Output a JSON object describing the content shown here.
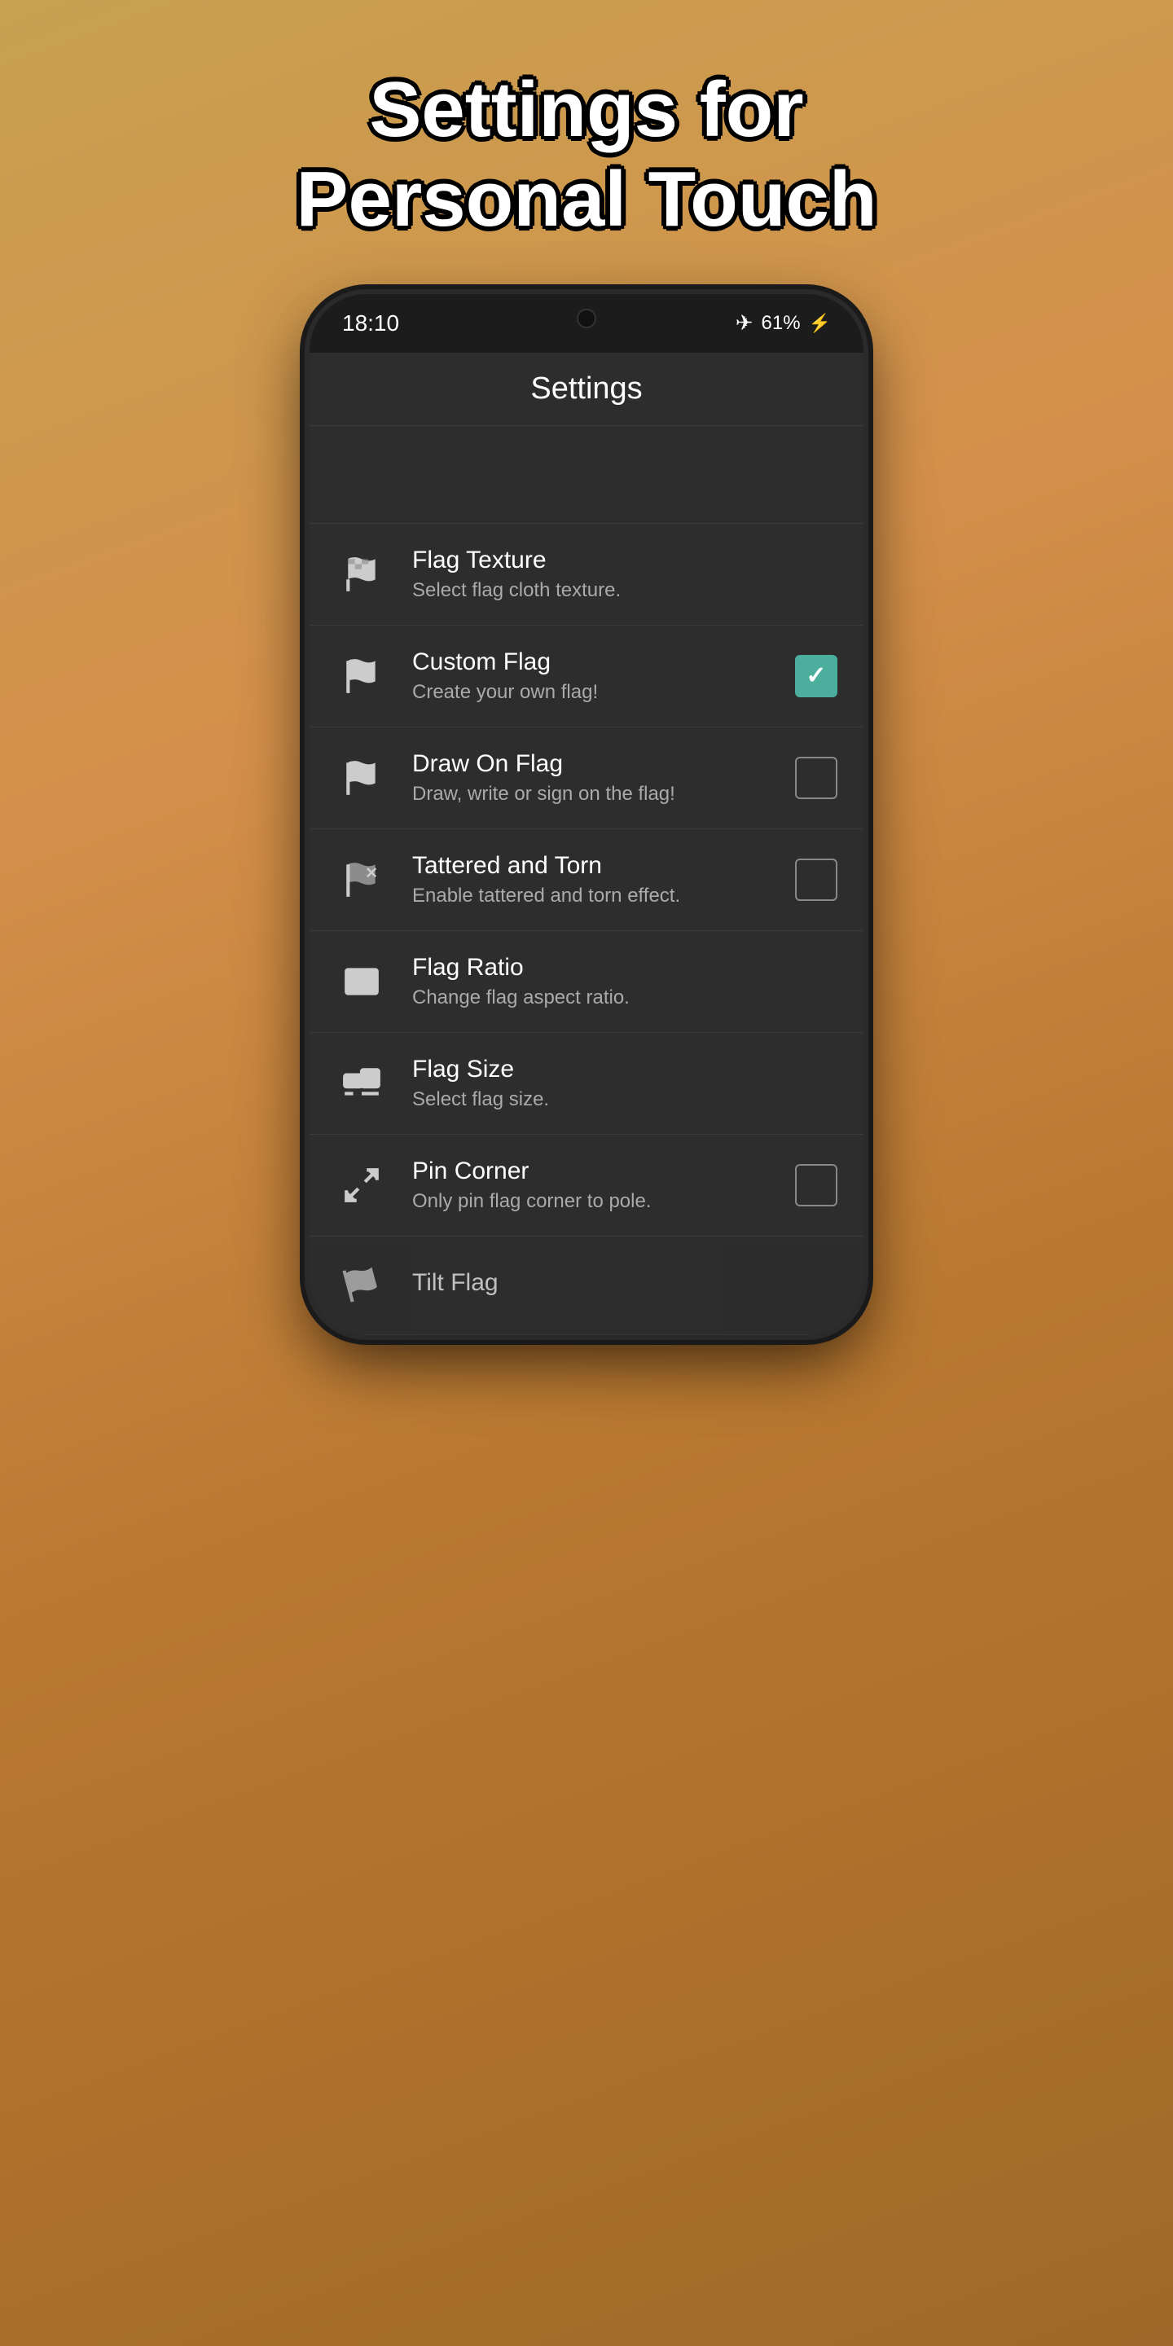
{
  "page": {
    "title_line1": "Settings for",
    "title_line2": "Personal Touch"
  },
  "status_bar": {
    "time": "18:10",
    "battery_percent": "61%",
    "wifi_icon": "✈"
  },
  "app_bar": {
    "title": "Settings"
  },
  "settings_items": [
    {
      "id": "flag-texture",
      "title": "Flag Texture",
      "subtitle": "Select flag cloth texture.",
      "has_checkbox": false,
      "checked": false
    },
    {
      "id": "custom-flag",
      "title": "Custom Flag",
      "subtitle": "Create your own flag!",
      "has_checkbox": true,
      "checked": true
    },
    {
      "id": "draw-on-flag",
      "title": "Draw On Flag",
      "subtitle": "Draw, write or sign on the flag!",
      "has_checkbox": true,
      "checked": false
    },
    {
      "id": "tattered-torn",
      "title": "Tattered and Torn",
      "subtitle": "Enable tattered and torn effect.",
      "has_checkbox": true,
      "checked": false
    },
    {
      "id": "flag-ratio",
      "title": "Flag Ratio",
      "subtitle": "Change flag aspect ratio.",
      "has_checkbox": false,
      "checked": false
    },
    {
      "id": "flag-size",
      "title": "Flag Size",
      "subtitle": "Select flag size.",
      "has_checkbox": false,
      "checked": false
    },
    {
      "id": "pin-corner",
      "title": "Pin Corner",
      "subtitle": "Only pin flag corner to pole.",
      "has_checkbox": true,
      "checked": false
    },
    {
      "id": "tilt-flag",
      "title": "Tilt Flag",
      "subtitle": "",
      "has_checkbox": false,
      "checked": false
    }
  ],
  "colors": {
    "checkbox_checked": "#4caf9e",
    "icon_color": "#cccccc"
  }
}
